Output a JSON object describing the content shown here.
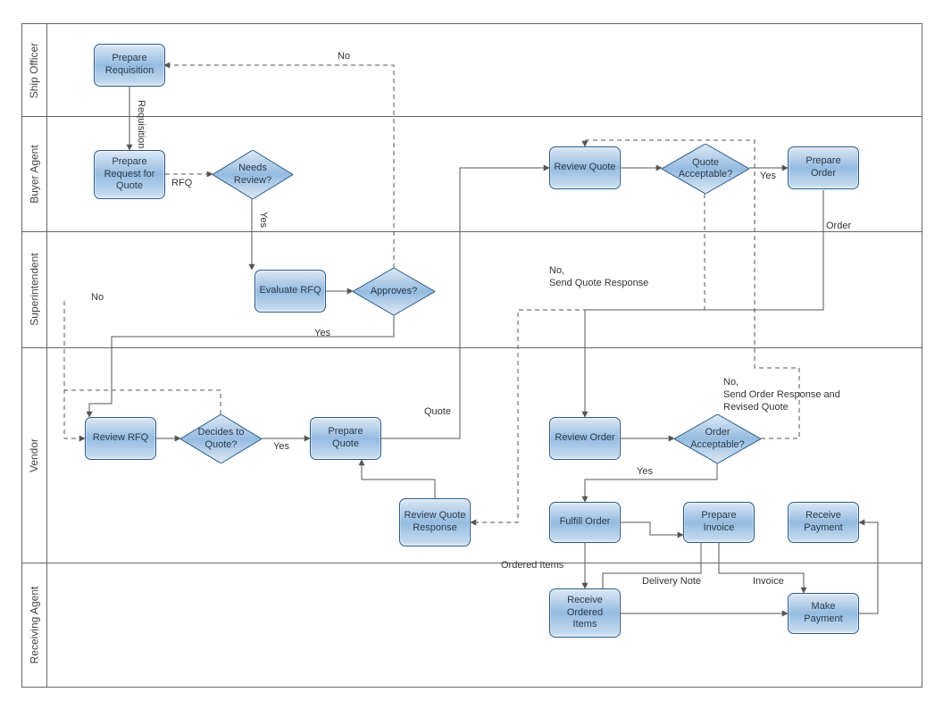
{
  "lanes": {
    "l1": "Ship Officer",
    "l2": "Buyer Agent",
    "l3": "Superintendent",
    "l4": "Vendor",
    "l5": "Receiving Agent"
  },
  "nodes": {
    "prepreq": "Prepare Requisition",
    "preprfq": "Prepare Request for Quote",
    "needsreview": "Needs Review?",
    "evalrfq": "Evaluate RFQ",
    "approves": "Approves?",
    "reviewrfq": "Review RFQ",
    "decidesquote": "Decides to Quote?",
    "prepquote": "Prepare Quote",
    "reviewquote": "Review Quote",
    "quoteacc": "Quote Acceptable?",
    "preporder": "Prepare Order",
    "revieworder": "Review Order",
    "orderacc": "Order Acceptable?",
    "reviewquoteresp": "Review Quote Response",
    "fulfillorder": "Fulfill Order",
    "prepinvoice": "Prepare Invoice",
    "recvpayment": "Receive Payment",
    "recvitems": "Receive Ordered Items",
    "makepayment": "Make Payment"
  },
  "edges": {
    "requisition": "Requisition",
    "rfq": "RFQ",
    "yes1": "Yes",
    "no_top": "No",
    "yes_approves": "Yes",
    "no_approves": "No",
    "yes_decides": "Yes",
    "quote": "Quote",
    "yes_quote": "Yes",
    "no_quote": "No,\nSend Quote Response",
    "order": "Order",
    "yes_order": "Yes",
    "no_order": "No,\nSend Order Response and\nRevised Quote",
    "ordereditems": "Ordered Items",
    "deliverynote": "Delivery Note",
    "invoice": "Invoice"
  }
}
